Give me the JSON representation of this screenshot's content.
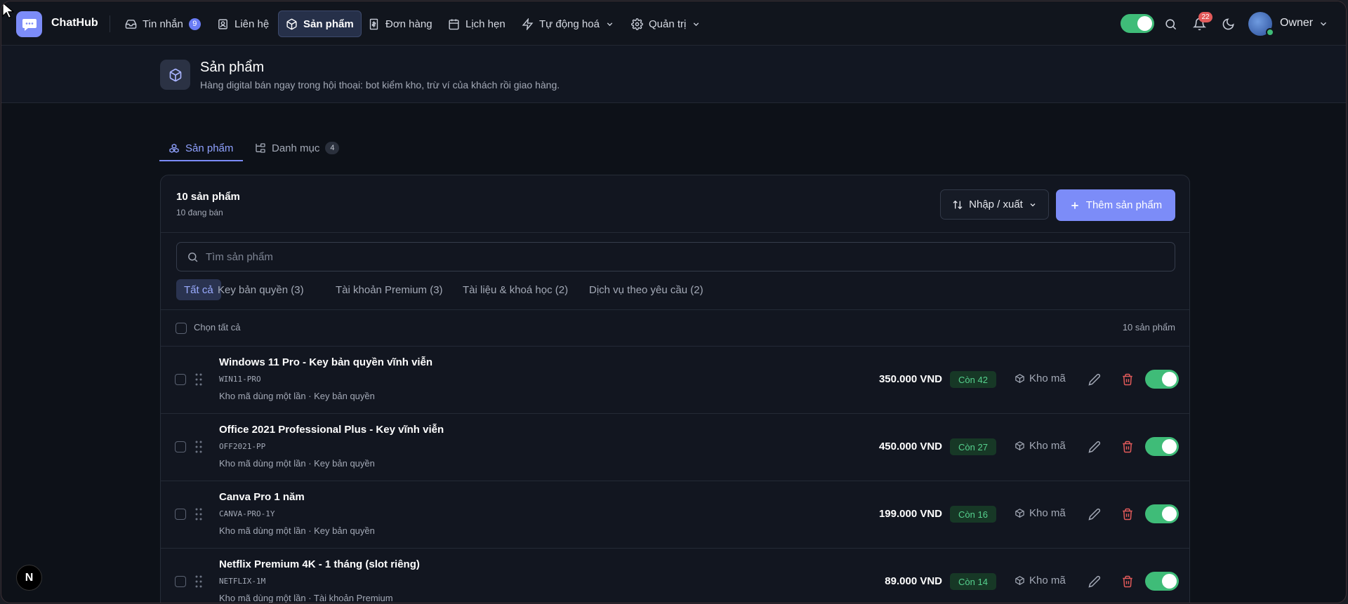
{
  "app": {
    "name": "ChatHub"
  },
  "nav": {
    "items": [
      {
        "label": "Tin nhắn",
        "badge": "9"
      },
      {
        "label": "Liên hệ"
      },
      {
        "label": "Sản phẩm"
      },
      {
        "label": "Đơn hàng"
      },
      {
        "label": "Lịch hẹn"
      },
      {
        "label": "Tự động hoá"
      },
      {
        "label": "Quản trị"
      }
    ],
    "notifications": "22",
    "user": "Owner"
  },
  "page": {
    "title": "Sản phẩm",
    "subtitle": "Hàng digital bán ngay trong hội thoại: bot kiểm kho, trừ ví của khách rồi giao hàng."
  },
  "tabs": [
    {
      "label": "Sản phẩm"
    },
    {
      "label": "Danh mục",
      "count": "4"
    }
  ],
  "card": {
    "title": "10 sản phẩm",
    "subtitle": "10 đang bán",
    "io_button": "Nhập / xuất",
    "add_button": "Thêm sản phẩm",
    "search_placeholder": "Tìm sản phẩm",
    "filters": [
      "Tất cả",
      "Key bản quyền (3)",
      "Tài khoản Premium (3)",
      "Tài liệu & khoá học (2)",
      "Dịch vụ theo yêu cầu (2)"
    ],
    "select_all": "Chọn tất cả",
    "count_right": "10 sản phẩm"
  },
  "products": [
    {
      "name": "Windows 11 Pro - Key bản quyền vĩnh viễn",
      "sku": "WIN11-PRO",
      "meta": "Kho mã dùng một lần · Key bản quyền",
      "price": "350.000 VND",
      "stock": "Còn 42",
      "source": "Kho mã",
      "active": true
    },
    {
      "name": "Office 2021 Professional Plus - Key vĩnh viễn",
      "sku": "OFF2021-PP",
      "meta": "Kho mã dùng một lần · Key bản quyền",
      "price": "450.000 VND",
      "stock": "Còn 27",
      "source": "Kho mã",
      "active": true
    },
    {
      "name": "Canva Pro 1 năm",
      "sku": "CANVA-PRO-1Y",
      "meta": "Kho mã dùng một lần · Key bản quyền",
      "price": "199.000 VND",
      "stock": "Còn 16",
      "source": "Kho mã",
      "active": true
    },
    {
      "name": "Netflix Premium 4K - 1 tháng (slot riêng)",
      "sku": "NETFLIX-1M",
      "meta": "Kho mã dùng một lần · Tài khoản Premium",
      "price": "89.000 VND",
      "stock": "Còn 14",
      "source": "Kho mã",
      "active": true
    }
  ],
  "floating_badge": "N",
  "colors": {
    "accent": "#7c8cf8",
    "success": "#3fbc78",
    "danger": "#e25a5a"
  }
}
